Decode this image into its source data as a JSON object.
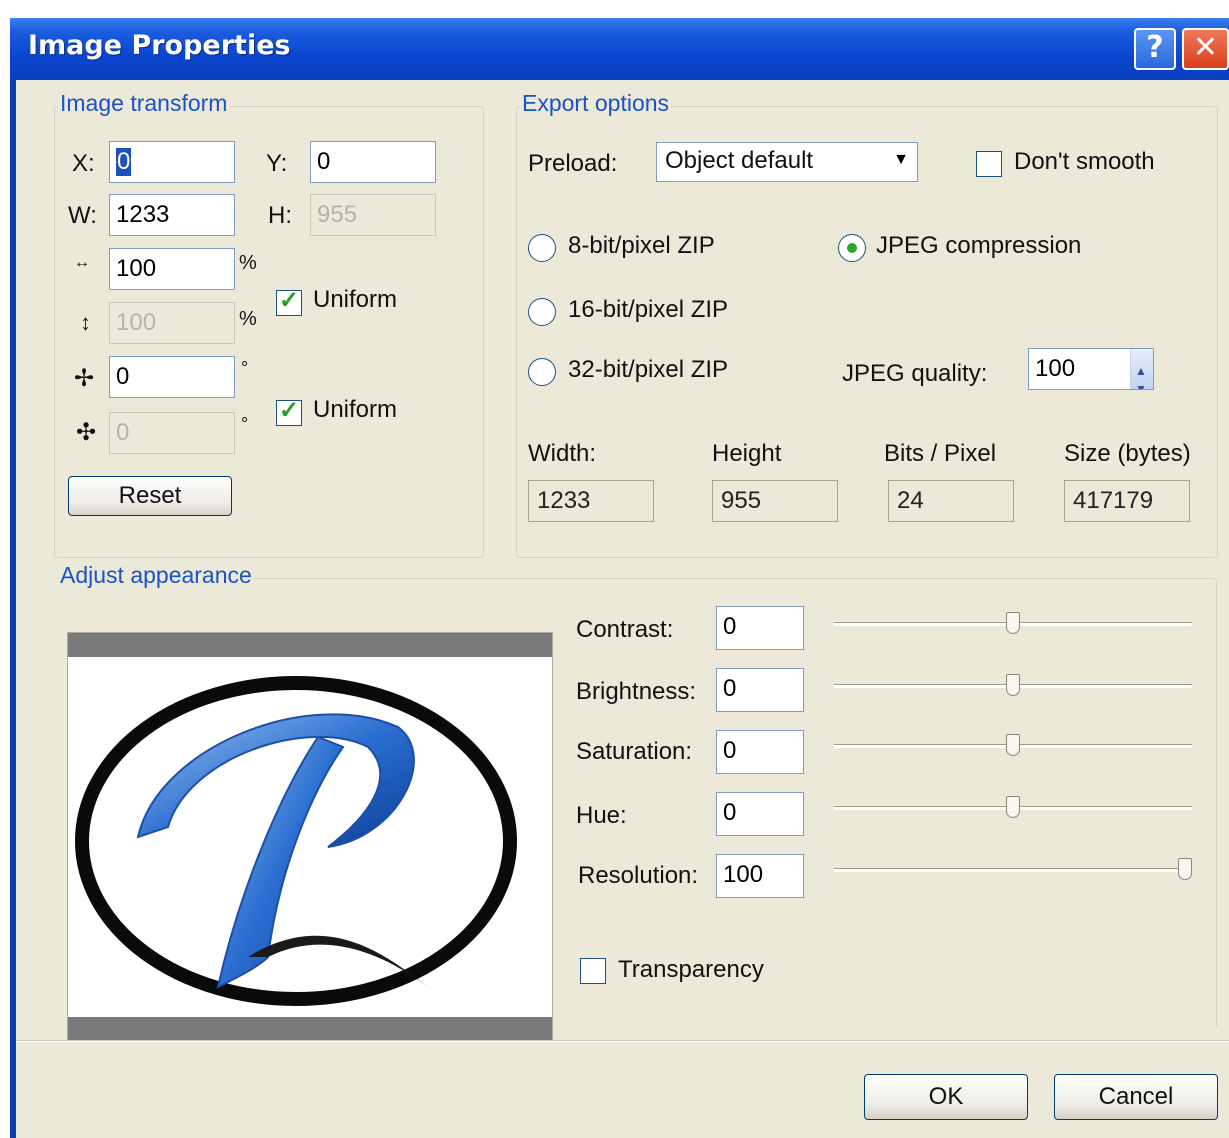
{
  "dialog": {
    "title": "Image Properties",
    "help_label": "?",
    "close_label": "✕"
  },
  "transform": {
    "group_title": "Image transform",
    "x_label": "X:",
    "x_value": "0",
    "y_label": "Y:",
    "y_value": "0",
    "w_label": "W:",
    "w_value": "1233",
    "h_label": "H:",
    "h_value": "955",
    "hscale_value": "100",
    "hscale_unit": "%",
    "vscale_value": "100",
    "vscale_unit": "%",
    "rot1_value": "0",
    "rot1_unit": "°",
    "rot2_value": "0",
    "rot2_unit": "°",
    "uniform_label": "Uniform",
    "uniform_checked": true,
    "uniform2_label": "Uniform",
    "uniform2_checked": true,
    "reset_label": "Reset"
  },
  "export": {
    "group_title": "Export options",
    "preload_label": "Preload:",
    "preload_value": "Object default",
    "dont_smooth_label": "Don't smooth",
    "dont_smooth_checked": false,
    "radio_8bit": "8-bit/pixel ZIP",
    "radio_16bit": "16-bit/pixel ZIP",
    "radio_32bit": "32-bit/pixel ZIP",
    "radio_jpeg": "JPEG compression",
    "selected": "JPEG compression",
    "jpeg_quality_label": "JPEG quality:",
    "jpeg_quality_value": "100",
    "width_label": "Width:",
    "width_value": "1233",
    "height_label": "Height",
    "height_value": "955",
    "bpp_label": "Bits / Pixel",
    "bpp_value": "24",
    "size_label": "Size (bytes)",
    "size_value": "417179"
  },
  "appearance": {
    "group_title": "Adjust appearance",
    "contrast_label": "Contrast:",
    "contrast_value": "0",
    "brightness_label": "Brightness:",
    "brightness_value": "0",
    "saturation_label": "Saturation:",
    "saturation_value": "0",
    "hue_label": "Hue:",
    "hue_value": "0",
    "resolution_label": "Resolution:",
    "resolution_value": "100",
    "transparency_label": "Transparency",
    "transparency_checked": false
  },
  "buttons": {
    "ok_label": "OK",
    "cancel_label": "Cancel"
  },
  "colors": {
    "title_bar": "#0a46cf",
    "accent_text": "#1a52c8",
    "dialog_bg": "#ece9d8",
    "logo_blue": "#2c6fd1"
  },
  "icons": [
    "help-icon",
    "close-icon",
    "horizontal-scale-icon",
    "vertical-scale-icon",
    "rotate-icon",
    "skew-icon",
    "dropdown-arrow-icon",
    "spinner-icon"
  ]
}
